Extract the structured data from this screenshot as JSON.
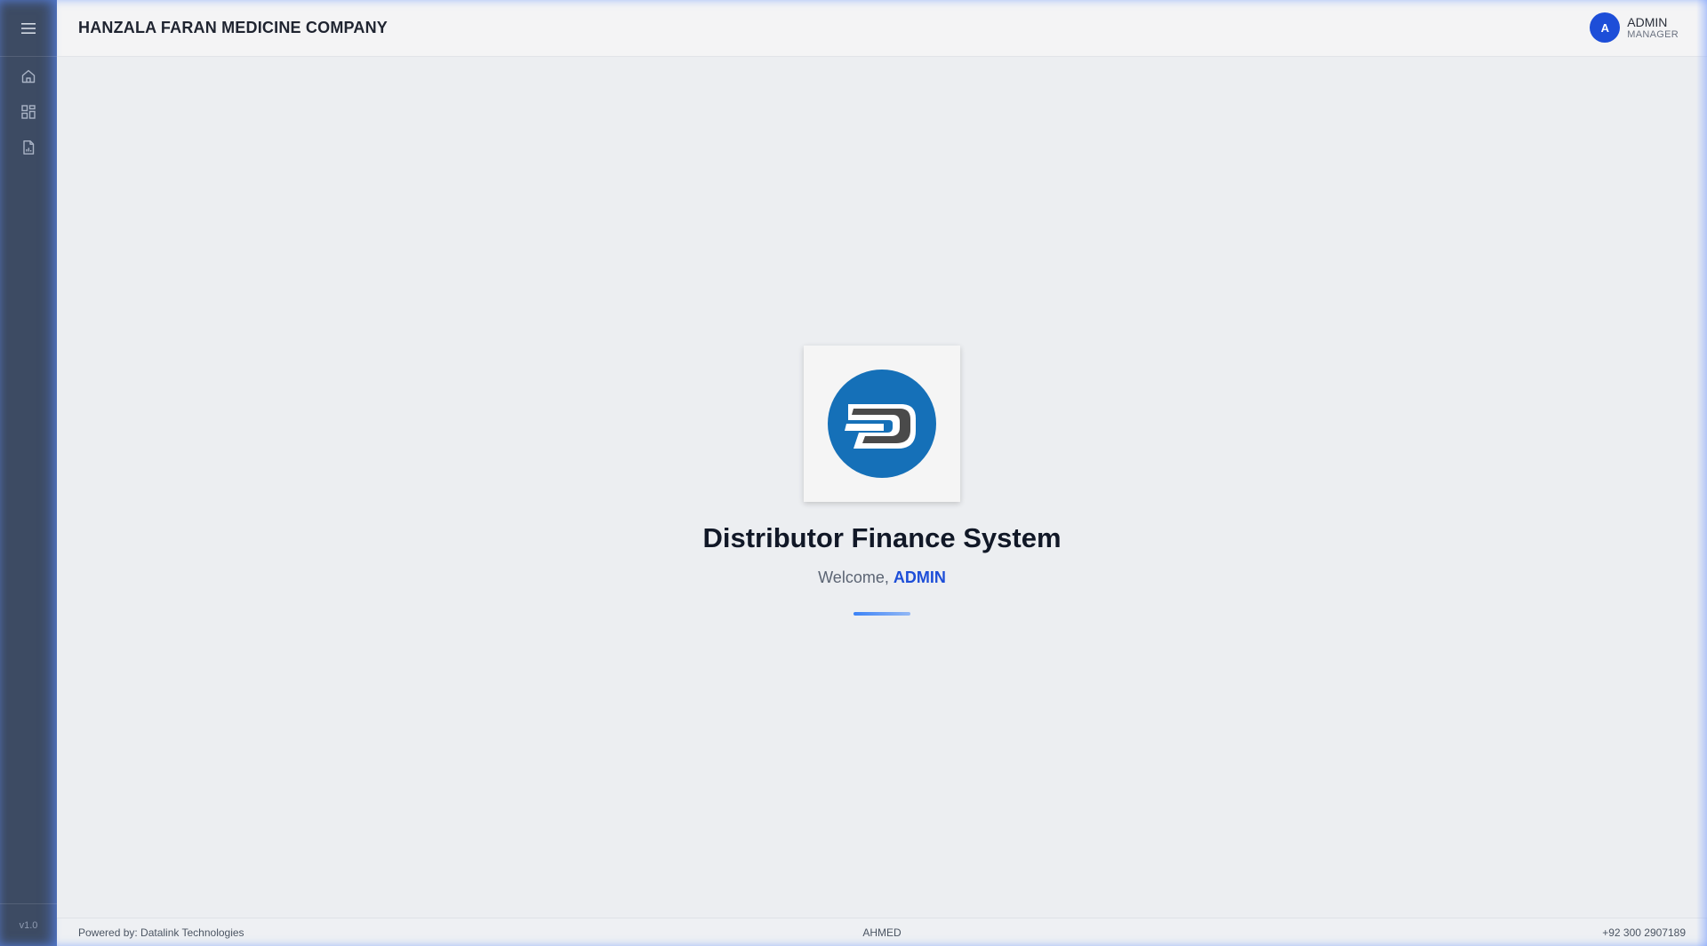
{
  "sidebar": {
    "menu_icon": "hamburger-menu-icon",
    "items": [
      {
        "icon": "home-icon"
      },
      {
        "icon": "dashboard-grid-icon"
      },
      {
        "icon": "report-document-icon"
      }
    ],
    "version": "v1.0"
  },
  "header": {
    "company_name": "HANZALA FARAN MEDICINE COMPANY",
    "user": {
      "avatar_letter": "A",
      "name": "ADMIN",
      "role": "MANAGER"
    }
  },
  "main": {
    "logo_icon": "distributor-logo",
    "title": "Distributor Finance System",
    "welcome_prefix": "Welcome, ",
    "welcome_user": "ADMIN"
  },
  "footer": {
    "powered_by": "Powered by: Datalink Technologies",
    "center_text": "AHMED",
    "phone": "+92 300 2907189"
  },
  "colors": {
    "sidebar": "#3d4b63",
    "accent": "#1d4ed8",
    "logo_blue": "#1570b8",
    "logo_gray": "#4a4a4a"
  }
}
